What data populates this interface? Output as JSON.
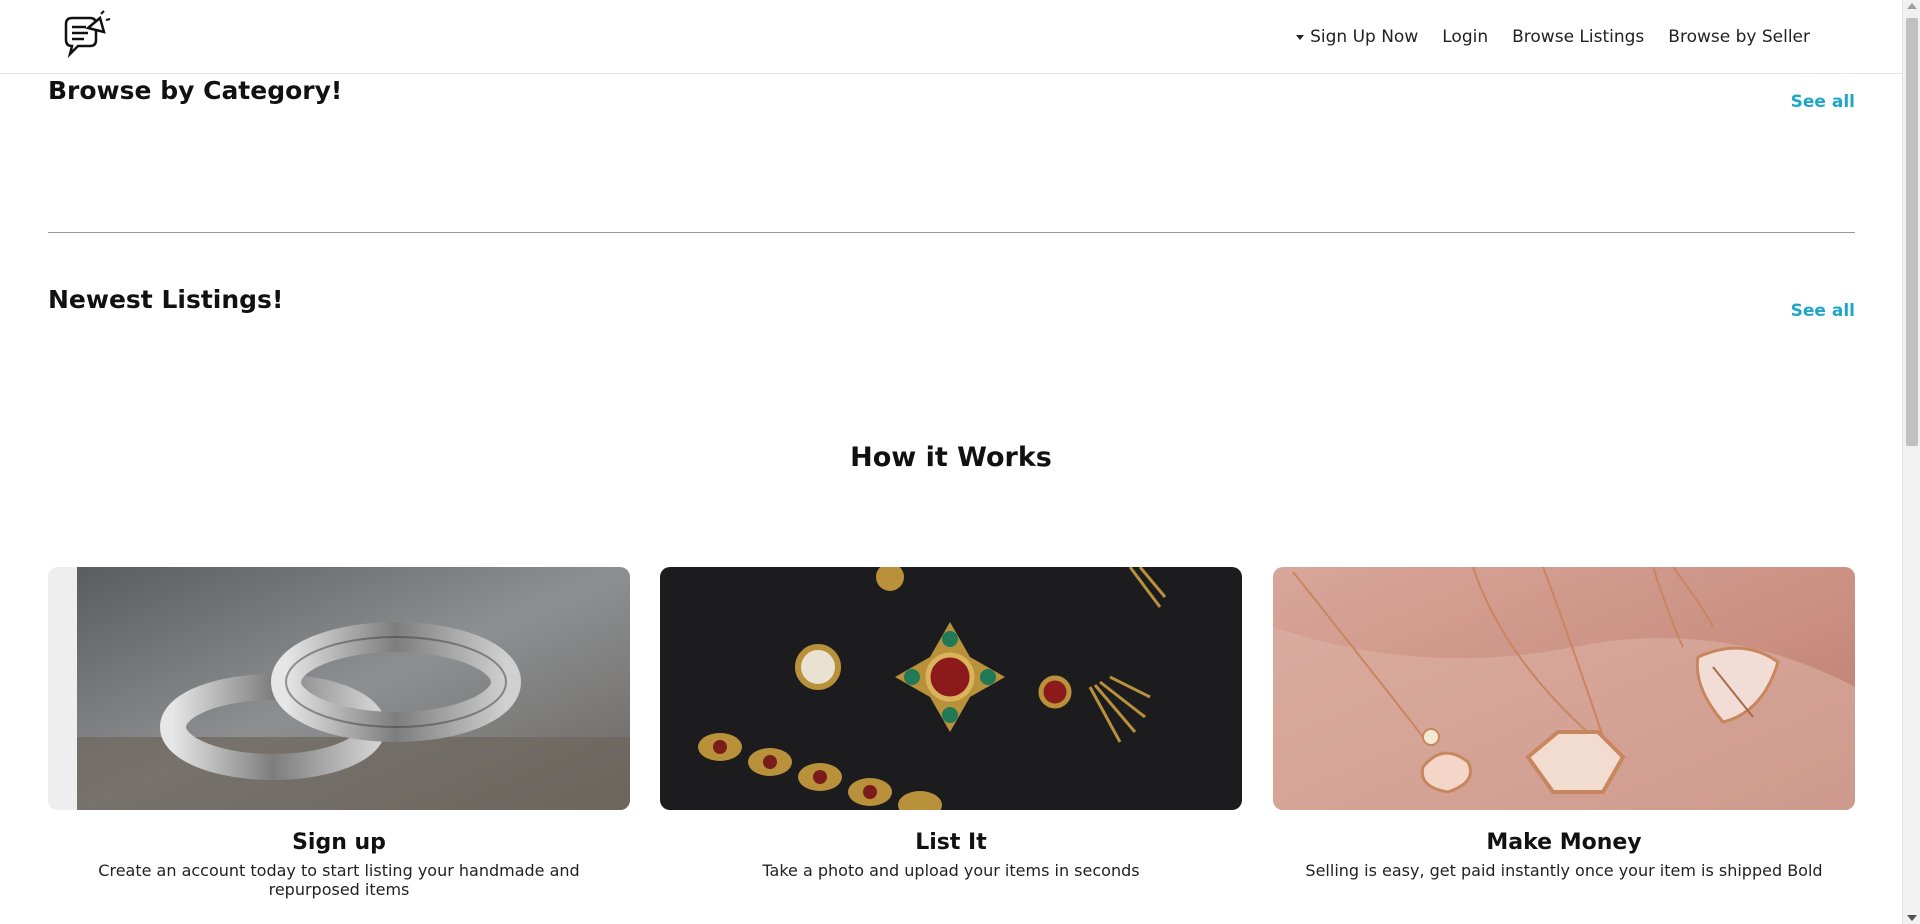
{
  "header": {
    "logo_icon": "megaphone-chat-icon",
    "nav": [
      {
        "label": "Sign Up Now",
        "has_caret": true
      },
      {
        "label": "Login"
      },
      {
        "label": "Browse Listings"
      },
      {
        "label": "Browse by Seller"
      }
    ]
  },
  "category_section": {
    "title": "Browse by Category!",
    "see_all": "See all"
  },
  "newest_section": {
    "title": "Newest Listings!",
    "see_all": "See all"
  },
  "how_it_works": {
    "title": "How it Works",
    "cards": [
      {
        "title": "Sign up",
        "description": "Create an account today to start listing your handmade and repurposed items",
        "image": "silver-rings-photo"
      },
      {
        "title": "List It",
        "description": "Take a photo and upload your items in seconds",
        "image": "vintage-jewelry-photo"
      },
      {
        "title": "Make Money",
        "description": "Selling is easy, get paid instantly once your item is shipped Bold",
        "image": "necklaces-in-hand-photo"
      }
    ]
  },
  "colors": {
    "accent": "#1fa6c8",
    "divider": "#9a9a9a"
  }
}
